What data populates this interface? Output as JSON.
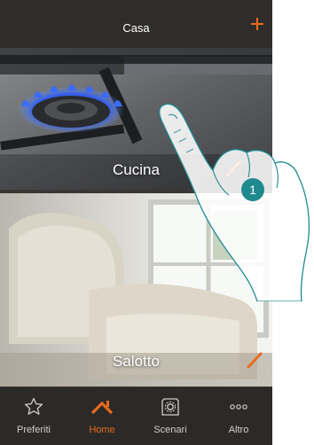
{
  "header": {
    "title": "Casa",
    "add_icon": "plus-icon"
  },
  "rooms": [
    {
      "label": "Cucina",
      "image": "gas-stove-burner-photo",
      "edit_icon": "pencil-icon"
    },
    {
      "label": "Salotto",
      "image": "armchair-photo",
      "edit_icon": "pencil-icon"
    }
  ],
  "tabs": [
    {
      "label": "Preferiti",
      "icon": "star-icon",
      "active": false
    },
    {
      "label": "Home",
      "icon": "house-icon",
      "active": true
    },
    {
      "label": "Scenari",
      "icon": "scenario-icon",
      "active": false
    },
    {
      "label": "Altro",
      "icon": "more-icon",
      "active": false
    }
  ],
  "callout": {
    "number": "1"
  },
  "colors": {
    "accent": "#e86a1e",
    "bar_background": "#2f2d2b",
    "badge": "#1f8a8e"
  }
}
